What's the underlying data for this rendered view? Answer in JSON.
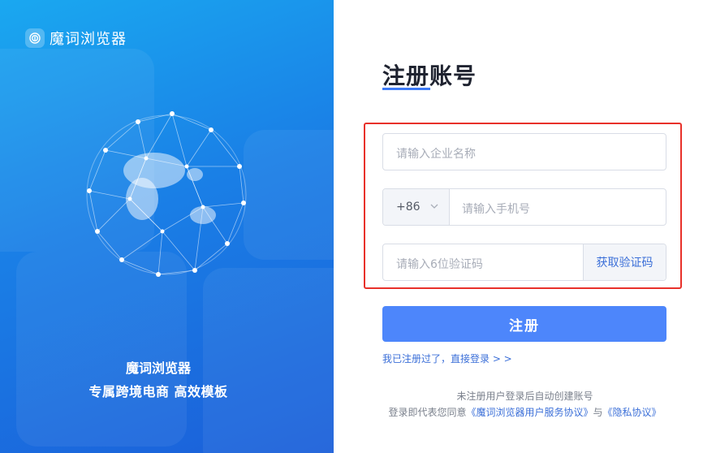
{
  "brand": {
    "name": "魔词浏览器"
  },
  "slogan": {
    "line1": "魔词浏览器",
    "line2": "专属跨境电商  高效模板"
  },
  "form": {
    "title": "注册账号",
    "company_placeholder": "请输入企业名称",
    "country_code": "+86",
    "phone_placeholder": "请输入手机号",
    "code_placeholder": "请输入6位验证码",
    "get_code_label": "获取验证码",
    "submit_label": "注册",
    "login_link": "我已注册过了，直接登录 > >"
  },
  "footer": {
    "auto_create_note": "未注册用户登录后自动创建账号",
    "agree_prefix": "登录即代表您同意",
    "service_link": "《魔词浏览器用户服务协议》",
    "and": "与",
    "privacy_link": "《隐私协议》"
  },
  "colors": {
    "accent": "#4d86fb",
    "link": "#3b6fd8",
    "highlight": "#e8312a"
  }
}
